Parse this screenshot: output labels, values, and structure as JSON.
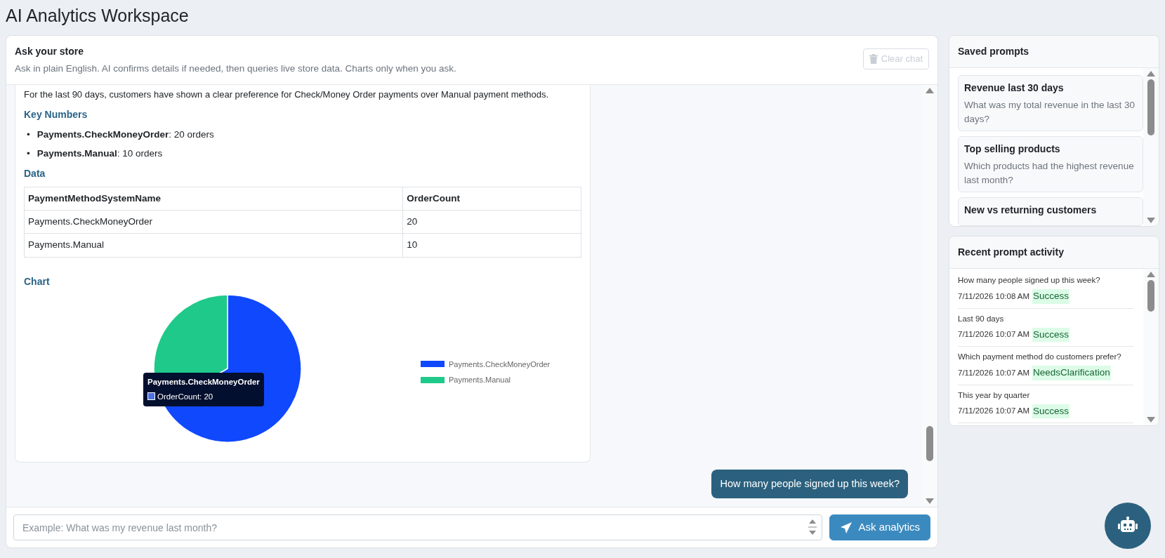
{
  "page_title": "AI Analytics Workspace",
  "chat": {
    "title": "Ask your store",
    "subtitle": "Ask in plain English. AI confirms details if needed, then queries live store data. Charts only when you ask.",
    "clear_button": {
      "label": "Clear chat",
      "disabled": true
    },
    "messages": [
      {
        "kind": "assistant",
        "summary": "For the last 90 days, customers have shown a clear preference for Check/Money Order payments over Manual payment methods.",
        "key_numbers_heading": "Key Numbers",
        "key_numbers": [
          {
            "marker": "•",
            "text": "**Payments.CheckMoneyOrder**: 20 orders"
          },
          {
            "marker": "•",
            "text": "**Payments.Manual**: 10 orders"
          }
        ],
        "data_heading": "Data",
        "table": {
          "columns": [
            "PaymentMethodSystemName",
            "OrderCount"
          ],
          "rows": [
            [
              "Payments.CheckMoneyOrder",
              "20"
            ],
            [
              "Payments.Manual",
              "10"
            ]
          ]
        },
        "chart_data": {
          "type": "pie",
          "title": "Chart",
          "categories": [
            "Payments.CheckMoneyOrder",
            "Payments.Manual"
          ],
          "values": [
            66.67,
            33.33
          ],
          "legend": "right"
        },
        "tooltip": {
          "title": "Payments.CheckMoneyOrder",
          "label": "OrderCount: 20"
        }
      },
      {
        "kind": "user",
        "text": "How many people signed up this week?"
      }
    ],
    "input": {
      "placeholder": "Example: What was my revenue last month?"
    },
    "send_button": {
      "label": "Ask analytics"
    }
  },
  "saved_prompts": {
    "title": "Saved prompts",
    "items": [
      {
        "title": "Revenue last 30 days",
        "text": "What was my total revenue in the last 30 days?"
      },
      {
        "title": "Top selling products",
        "text": "Which products had the highest revenue last month?"
      },
      {
        "title": "New vs returning customers"
      }
    ]
  },
  "recent_activity": {
    "title": "Recent prompt activity",
    "items": [
      {
        "prompt": "How many people signed up this week?",
        "time": "7/11/2026 10:08 AM",
        "status": "Success"
      },
      {
        "prompt": "Last 90 days",
        "time": "7/11/2026 10:07 AM",
        "status": "Success"
      },
      {
        "prompt": "Which payment method do customers prefer?",
        "time": "7/11/2026 10:07 AM",
        "status": "NeedsClarification"
      },
      {
        "prompt": "This year by quarter",
        "time": "7/11/2026 10:07 AM",
        "status": "Success"
      }
    ]
  }
}
